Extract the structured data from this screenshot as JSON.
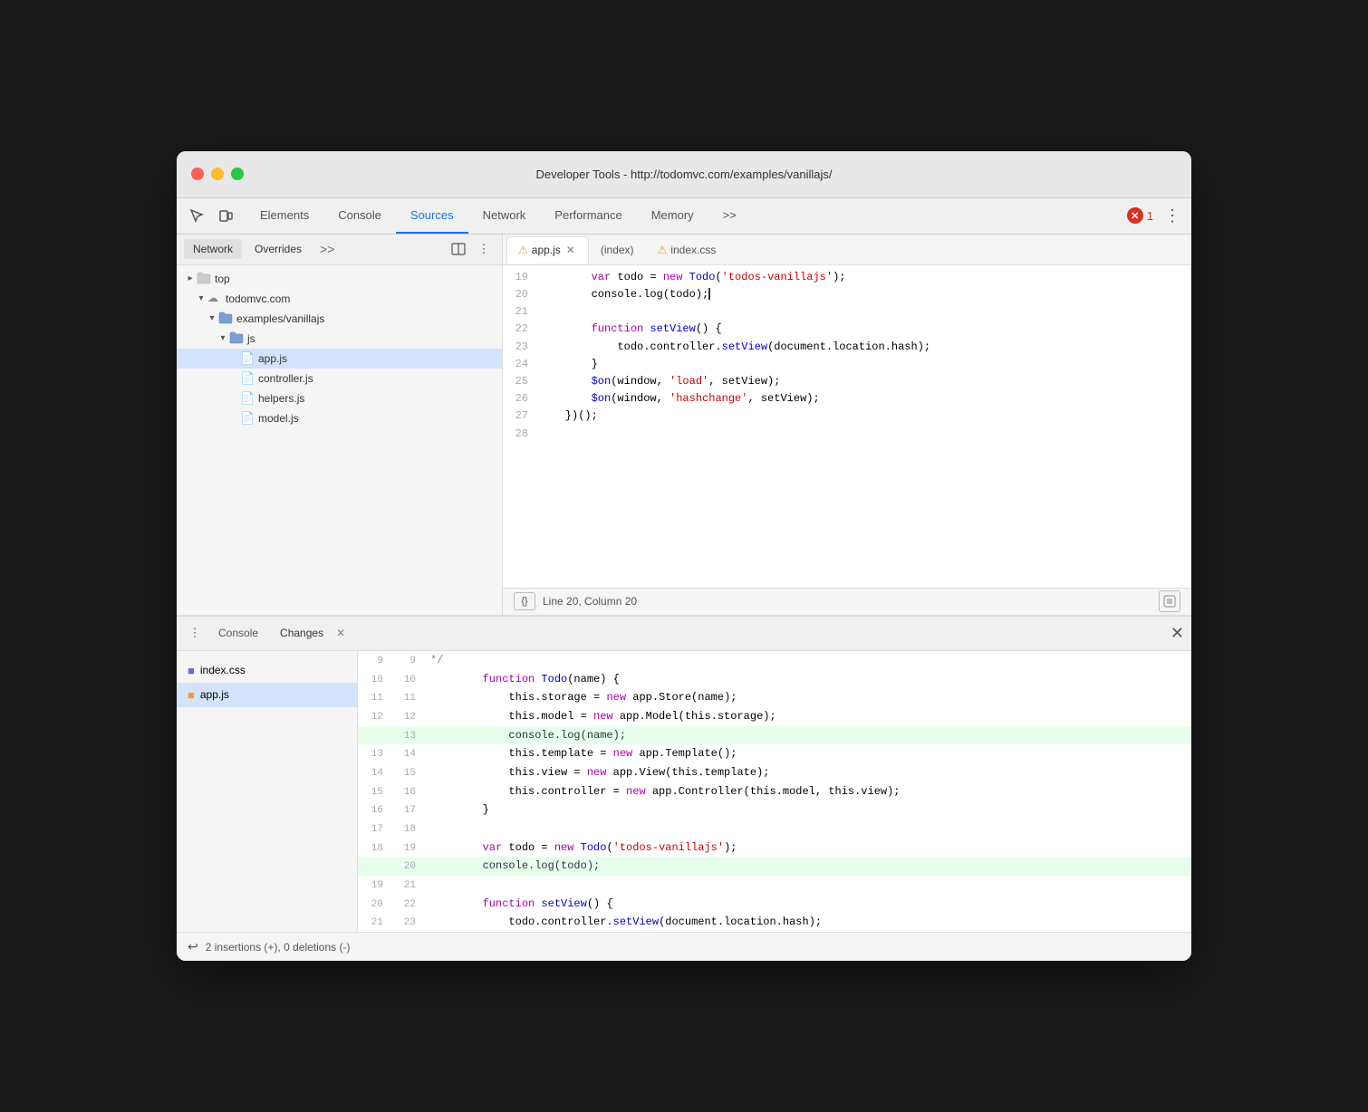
{
  "window": {
    "title": "Developer Tools - http://todomvc.com/examples/vanillajs/"
  },
  "devtools": {
    "tabs": [
      {
        "id": "elements",
        "label": "Elements",
        "active": false
      },
      {
        "id": "console",
        "label": "Console",
        "active": false
      },
      {
        "id": "sources",
        "label": "Sources",
        "active": true
      },
      {
        "id": "network",
        "label": "Network",
        "active": false
      },
      {
        "id": "performance",
        "label": "Performance",
        "active": false
      },
      {
        "id": "memory",
        "label": "Memory",
        "active": false
      }
    ],
    "error_count": "1",
    "more_tabs": ">>"
  },
  "left_panel": {
    "tabs": [
      {
        "label": "Network",
        "active": true
      },
      {
        "label": "Overrides",
        "active": false
      }
    ],
    "more": ">>",
    "tree": [
      {
        "label": "top",
        "type": "collapsed",
        "icon": "triangle-folder",
        "depth": 0
      },
      {
        "label": "todomvc.com",
        "type": "expanded",
        "icon": "domain",
        "depth": 1
      },
      {
        "label": "examples/vanillajs",
        "type": "expanded",
        "icon": "folder",
        "depth": 2
      },
      {
        "label": "js",
        "type": "expanded",
        "icon": "folder",
        "depth": 3
      },
      {
        "label": "app.js",
        "type": "file",
        "icon": "js",
        "depth": 4,
        "selected": true
      },
      {
        "label": "controller.js",
        "type": "file",
        "icon": "js",
        "depth": 4
      },
      {
        "label": "helpers.js",
        "type": "file",
        "icon": "js",
        "depth": 4
      },
      {
        "label": "model.js",
        "type": "file",
        "icon": "js",
        "depth": 4
      }
    ]
  },
  "editor": {
    "tabs": [
      {
        "id": "appjs",
        "label": "app.js",
        "warning": true,
        "closeable": true,
        "active": true
      },
      {
        "id": "index",
        "label": "(index)",
        "warning": false,
        "closeable": false,
        "active": false
      },
      {
        "id": "indexcss",
        "label": "index.css",
        "warning": true,
        "closeable": false,
        "active": false
      }
    ],
    "code_lines": [
      {
        "num": "19",
        "tokens": [
          {
            "type": "plain",
            "text": "        "
          },
          {
            "type": "kw",
            "text": "var"
          },
          {
            "type": "plain",
            "text": " todo = "
          },
          {
            "type": "kw",
            "text": "new"
          },
          {
            "type": "plain",
            "text": " "
          },
          {
            "type": "fn",
            "text": "Todo"
          },
          {
            "type": "plain",
            "text": "("
          },
          {
            "type": "str",
            "text": "'todos-vanillajs'"
          },
          {
            "type": "plain",
            "text": ");"
          }
        ]
      },
      {
        "num": "20",
        "tokens": [
          {
            "type": "plain",
            "text": "        console.log(todo);"
          }
        ]
      },
      {
        "num": "21",
        "tokens": [
          {
            "type": "plain",
            "text": ""
          }
        ]
      },
      {
        "num": "22",
        "tokens": [
          {
            "type": "plain",
            "text": "        "
          },
          {
            "type": "kw",
            "text": "function"
          },
          {
            "type": "plain",
            "text": " "
          },
          {
            "type": "fn",
            "text": "setView"
          },
          {
            "type": "plain",
            "text": "() {"
          }
        ]
      },
      {
        "num": "23",
        "tokens": [
          {
            "type": "plain",
            "text": "            todo.controller."
          },
          {
            "type": "fn",
            "text": "setView"
          },
          {
            "type": "plain",
            "text": "(document.location.hash);"
          }
        ]
      },
      {
        "num": "24",
        "tokens": [
          {
            "type": "plain",
            "text": "        }"
          }
        ]
      },
      {
        "num": "25",
        "tokens": [
          {
            "type": "plain",
            "text": "        "
          },
          {
            "type": "fn",
            "text": "$on"
          },
          {
            "type": "plain",
            "text": "(window, "
          },
          {
            "type": "str",
            "text": "'load'"
          },
          {
            "type": "plain",
            "text": ", setView);"
          }
        ]
      },
      {
        "num": "26",
        "tokens": [
          {
            "type": "plain",
            "text": "        "
          },
          {
            "type": "fn",
            "text": "$on"
          },
          {
            "type": "plain",
            "text": "(window, "
          },
          {
            "type": "str",
            "text": "'hashchange'"
          },
          {
            "type": "plain",
            "text": ", setView);"
          }
        ]
      },
      {
        "num": "27",
        "tokens": [
          {
            "type": "plain",
            "text": "    })();"
          }
        ]
      },
      {
        "num": "28",
        "tokens": [
          {
            "type": "plain",
            "text": ""
          }
        ]
      }
    ],
    "status": {
      "braces": "{}",
      "position": "Line 20, Column 20"
    }
  },
  "bottom_panel": {
    "tabs": [
      {
        "label": "Console",
        "active": false
      },
      {
        "label": "Changes",
        "active": true
      }
    ],
    "files": [
      {
        "label": "index.css",
        "icon": "css",
        "selected": false
      },
      {
        "label": "app.js",
        "icon": "js",
        "selected": true
      }
    ],
    "diff_lines": [
      {
        "old_num": "9",
        "new_num": "9",
        "type": "context",
        "content": "        */"
      },
      {
        "old_num": "10",
        "new_num": "10",
        "type": "context",
        "content": "        function Todo(name) {"
      },
      {
        "old_num": "11",
        "new_num": "11",
        "type": "context",
        "content": "            this.storage = new app.Store(name);"
      },
      {
        "old_num": "12",
        "new_num": "12",
        "type": "context",
        "content": "            this.model = new app.Model(this.storage);"
      },
      {
        "old_num": "",
        "new_num": "13",
        "type": "added",
        "content": "            console.log(name);"
      },
      {
        "old_num": "13",
        "new_num": "14",
        "type": "context",
        "content": "            this.template = new app.Template();"
      },
      {
        "old_num": "14",
        "new_num": "15",
        "type": "context",
        "content": "            this.view = new app.View(this.template);"
      },
      {
        "old_num": "15",
        "new_num": "16",
        "type": "context",
        "content": "            this.controller = new app.Controller(this.model, this.view);"
      },
      {
        "old_num": "16",
        "new_num": "17",
        "type": "context",
        "content": "        }"
      },
      {
        "old_num": "17",
        "new_num": "18",
        "type": "context",
        "content": ""
      },
      {
        "old_num": "18",
        "new_num": "19",
        "type": "context",
        "content": "        var todo = new Todo('todos-vanillajs');"
      },
      {
        "old_num": "",
        "new_num": "20",
        "type": "added",
        "content": "        console.log(todo);"
      },
      {
        "old_num": "19",
        "new_num": "21",
        "type": "context",
        "content": ""
      },
      {
        "old_num": "20",
        "new_num": "22",
        "type": "context",
        "content": "        function setView() {"
      },
      {
        "old_num": "21",
        "new_num": "23",
        "type": "context",
        "content": "            todo.controller.setView(document.location.hash);"
      }
    ],
    "status_text": "2 insertions (+), 0 deletions (-)"
  }
}
